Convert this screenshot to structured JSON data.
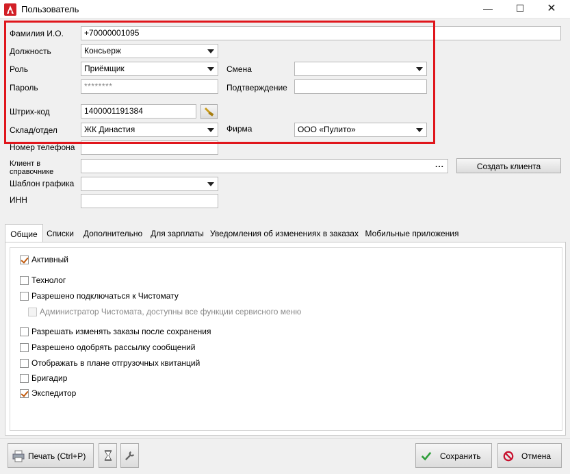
{
  "window": {
    "title": "Пользователь",
    "controls": {
      "minimize": "—",
      "maximize": "☐",
      "close": "✕"
    }
  },
  "form": {
    "fio": {
      "label": "Фамилия И.О.",
      "value": "+70000001095"
    },
    "position": {
      "label": "Должность",
      "value": "Консьерж"
    },
    "role": {
      "label": "Роль",
      "value": "Приёмщик"
    },
    "shift": {
      "label": "Смена",
      "value": ""
    },
    "password": {
      "label": "Пароль",
      "value": "********"
    },
    "confirm": {
      "label": "Подтверждение",
      "value": ""
    },
    "barcode": {
      "label": "Штрих-код",
      "value": "1400001191384"
    },
    "warehouse": {
      "label": "Склад/отдел",
      "value": "ЖК Династия"
    },
    "firm": {
      "label": "Фирма",
      "value": "ООО «Пулито»"
    },
    "phone": {
      "label": "Номер телефона",
      "value": ""
    },
    "client": {
      "label": "Клиент в справочнике",
      "value": "",
      "dots": "..."
    },
    "create_client": "Создать клиента",
    "schedule": {
      "label": "Шаблон графика",
      "value": ""
    },
    "inn": {
      "label": "ИНН",
      "value": ""
    }
  },
  "tabs": [
    {
      "label": "Общие",
      "active": true
    },
    {
      "label": "Списки",
      "active": false
    },
    {
      "label": "Дополнительно",
      "active": false
    },
    {
      "label": "Для зарплаты",
      "active": false
    },
    {
      "label": "Уведомления об изменениях в заказах",
      "active": false
    },
    {
      "label": "Мобильные приложения",
      "active": false
    }
  ],
  "checkboxes": [
    {
      "label": "Активный",
      "checked": true,
      "enabled": true
    },
    {
      "label": "Технолог",
      "checked": false,
      "enabled": true
    },
    {
      "label": "Разрешено подключаться к Чистомату",
      "checked": false,
      "enabled": true
    },
    {
      "label": "Администратор Чистомата, доступны все функции сервисного меню",
      "checked": false,
      "enabled": false
    },
    {
      "label": "Разрешать изменять заказы после сохранения",
      "checked": false,
      "enabled": true
    },
    {
      "label": "Разрешено одобрять рассылку сообщений",
      "checked": false,
      "enabled": true
    },
    {
      "label": "Отображать в плане отгрузочных квитанций",
      "checked": false,
      "enabled": true
    },
    {
      "label": "Бригадир",
      "checked": false,
      "enabled": true
    },
    {
      "label": "Экспедитор",
      "checked": true,
      "enabled": true
    }
  ],
  "footer": {
    "print": "Печать (Ctrl+P)",
    "save": "Сохранить",
    "cancel": "Отмена"
  },
  "colors": {
    "highlight": "#e0161c",
    "check": "#c0580a",
    "save_icon": "#2e9e3a",
    "cancel_icon": "#c8102e"
  }
}
